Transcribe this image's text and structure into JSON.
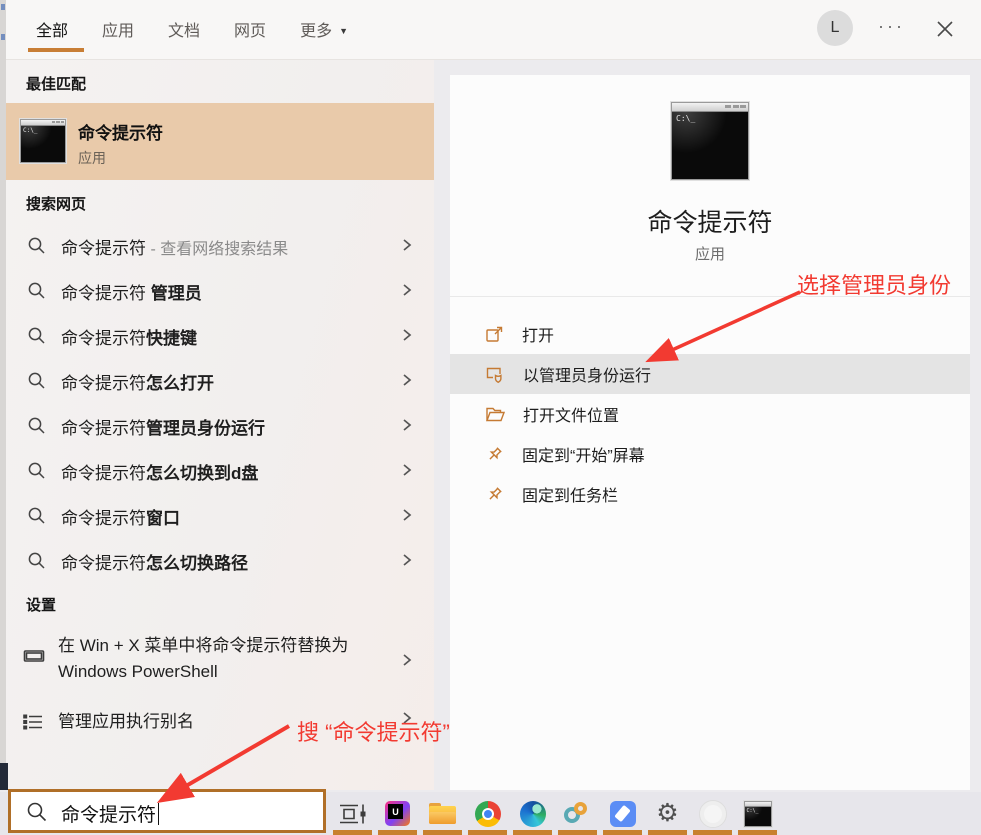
{
  "colors": {
    "accent_orange": "#c87e35",
    "best_match_highlight": "#e9caaa",
    "action_highlight": "#e4e4e4",
    "annotation_red": "#f23a31",
    "search_border": "#b06f28"
  },
  "topbar": {
    "tabs": [
      {
        "label": "全部",
        "active": true
      },
      {
        "label": "应用",
        "active": false
      },
      {
        "label": "文档",
        "active": false
      },
      {
        "label": "网页",
        "active": false
      }
    ],
    "more_label": "更多",
    "avatar_letter": "L",
    "ellipsis": "···"
  },
  "left": {
    "best_match_header": "最佳匹配",
    "best_match": {
      "title": "命令提示符",
      "subtitle": "应用"
    },
    "web_header": "搜索网页",
    "web_items": [
      {
        "prefix": "命令提示符",
        "suffix": " - 查看网络搜索结果"
      },
      {
        "prefix": "命令提示符 ",
        "suffix": "管理员"
      },
      {
        "prefix": "命令提示符",
        "suffix": "快捷键"
      },
      {
        "prefix": "命令提示符",
        "suffix": "怎么打开"
      },
      {
        "prefix": "命令提示符",
        "suffix": "管理员身份运行"
      },
      {
        "prefix": "命令提示符",
        "suffix": "怎么切换到d盘"
      },
      {
        "prefix": "命令提示符",
        "suffix": "窗口"
      },
      {
        "prefix": "命令提示符",
        "suffix": "怎么切换路径"
      }
    ],
    "settings_header": "设置",
    "settings_items": [
      {
        "label": "在 Win + X 菜单中将命令提示符替换为 Windows PowerShell",
        "icon": "monitor-icon"
      },
      {
        "label": "管理应用执行别名",
        "icon": "list-icon"
      }
    ]
  },
  "right": {
    "app_title": "命令提示符",
    "app_subtitle": "应用",
    "cmd_screen_text": "C:\\_",
    "actions": [
      {
        "label": "打开",
        "icon": "open-window-icon",
        "highlighted": false
      },
      {
        "label": "以管理员身份运行",
        "icon": "admin-shield-icon",
        "highlighted": true
      },
      {
        "label": "打开文件位置",
        "icon": "folder-icon",
        "highlighted": false
      },
      {
        "label": "固定到“开始”屏幕",
        "icon": "pin-icon",
        "highlighted": false
      },
      {
        "label": "固定到任务栏",
        "icon": "pin-icon",
        "highlighted": false
      }
    ]
  },
  "annotations": {
    "admin_hint": "选择管理员身份",
    "search_hint": "搜 “命令提示符”"
  },
  "search_box": {
    "value": "命令提示符"
  },
  "taskbar": {
    "icons": [
      "task-view-icon",
      "intellij-idea-icon",
      "file-explorer-icon",
      "chrome-icon",
      "edge-icon",
      "rings-app-icon",
      "notes-app-icon",
      "settings-gear-icon",
      "white-round-app-icon",
      "command-prompt-icon"
    ],
    "idea_letter": "U"
  }
}
